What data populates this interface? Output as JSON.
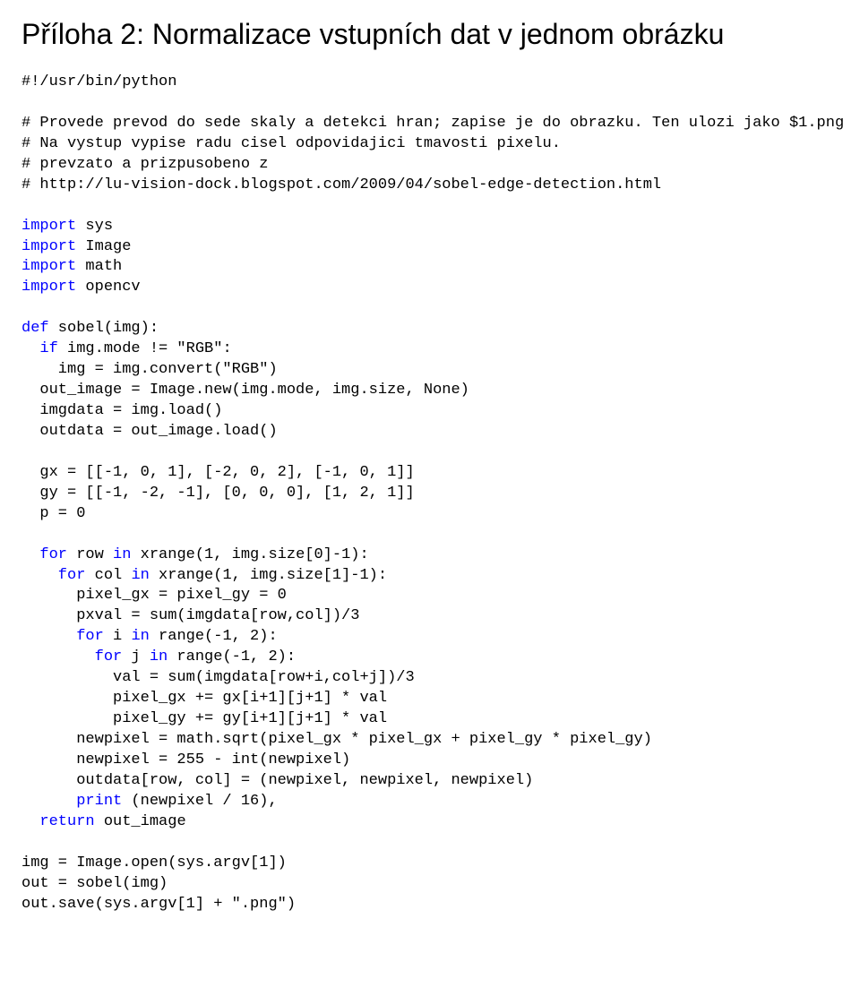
{
  "title": "Příloha 2: Normalizace vstupních dat v jednom obrázku",
  "code": {
    "l01": "#!/usr/bin/python",
    "l02": "",
    "l03": "# Provede prevod do sede skaly a detekci hran; zapise je do obrazku. Ten ulozi jako $1.png",
    "l04": "# Na vystup vypise radu cisel odpovidajici tmavosti pixelu.",
    "l05": "# prevzato a prizpusobeno z",
    "l06": "# http://lu-vision-dock.blogspot.com/2009/04/sobel-edge-detection.html",
    "l07": "",
    "l08a": "import",
    "l08b": " sys",
    "l09a": "import",
    "l09b": " Image",
    "l10a": "import",
    "l10b": " math",
    "l11a": "import",
    "l11b": " opencv",
    "l12": "",
    "l13a": "def",
    "l13b": " sobel(img):",
    "l14a": "  if",
    "l14b": " img.mode != \"RGB\":",
    "l15": "    img = img.convert(\"RGB\")",
    "l16": "  out_image = Image.new(img.mode, img.size, None)",
    "l17": "  imgdata = img.load()",
    "l18": "  outdata = out_image.load()",
    "l19": "",
    "l20": "  gx = [[-1, 0, 1], [-2, 0, 2], [-1, 0, 1]]",
    "l21": "  gy = [[-1, -2, -1], [0, 0, 0], [1, 2, 1]]",
    "l22": "  p = 0",
    "l23": "",
    "l24a": "  for",
    "l24b": " row ",
    "l24c": "in",
    "l24d": " xrange(1, img.size[0]-1):",
    "l25a": "    for",
    "l25b": " col ",
    "l25c": "in",
    "l25d": " xrange(1, img.size[1]-1):",
    "l26": "      pixel_gx = pixel_gy = 0",
    "l27": "      pxval = sum(imgdata[row,col])/3",
    "l28a": "      for",
    "l28b": " i ",
    "l28c": "in",
    "l28d": " range(-1, 2):",
    "l29a": "        for",
    "l29b": " j ",
    "l29c": "in",
    "l29d": " range(-1, 2):",
    "l30": "          val = sum(imgdata[row+i,col+j])/3",
    "l31": "          pixel_gx += gx[i+1][j+1] * val",
    "l32": "          pixel_gy += gy[i+1][j+1] * val",
    "l33": "      newpixel = math.sqrt(pixel_gx * pixel_gx + pixel_gy * pixel_gy)",
    "l34": "      newpixel = 255 - int(newpixel)",
    "l35": "      outdata[row, col] = (newpixel, newpixel, newpixel)",
    "l36a": "      print",
    "l36b": " (newpixel / 16),",
    "l37a": "  return",
    "l37b": " out_image",
    "l38": "",
    "l39": "img = Image.open(sys.argv[1])",
    "l40": "out = sobel(img)",
    "l41": "out.save(sys.argv[1] + \".png\")"
  }
}
